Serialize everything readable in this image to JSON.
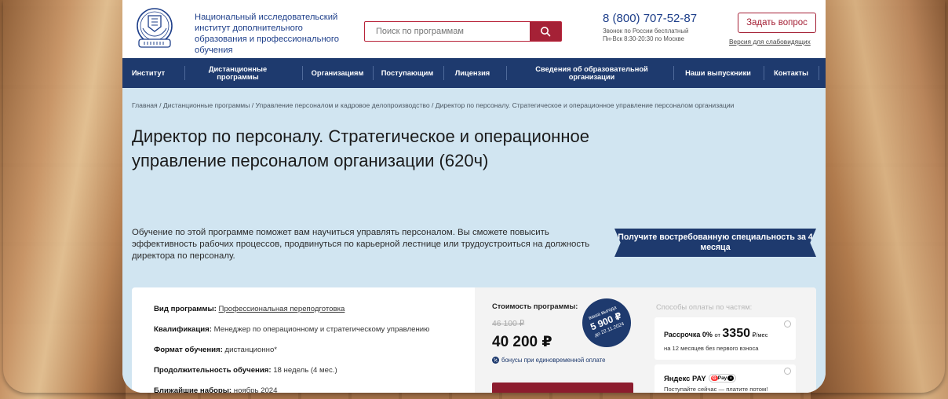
{
  "org": {
    "name": "Национальный исследовательский институт дополнительного образования и профессионального обучения"
  },
  "search": {
    "placeholder": "Поиск по программам"
  },
  "contact": {
    "phone": "8 (800) 707-52-87",
    "note1": "Звонок по России бесплатный",
    "note2": "Пн-Вск 8:30-20:30 по Москве",
    "ask_label": "Задать вопрос",
    "low_vision": "Версия для слабовидящих"
  },
  "nav": [
    "Институт",
    "Дистанционные программы",
    "Организациям",
    "Поступающим",
    "Лицензия",
    "Сведения об образовательной организации",
    "Наши выпускники",
    "Контакты"
  ],
  "breadcrumbs": "Главная / Дистанционные программы / Управление персоналом и кадровое делопроизводство / Директор по персоналу. Стратегическое и операционное управление персоналом организации",
  "hero": {
    "title": "Директор по персоналу. Стратегическое и операционное управление персоналом организации (620ч)",
    "description": "Обучение по этой программе поможет вам научиться управлять персоналом. Вы сможете повысить эффективность рабочих процессов, продвинуться по карьерной лестнице или трудоустроиться на должность директора по персоналу.",
    "banner": "Получите востребованную специальность за 4 месяца"
  },
  "program": {
    "type_label": "Вид программы:",
    "type_value": "Профессиональная переподготовка",
    "qual_label": "Квалификация:",
    "qual_value": "Менеджер по операционному и стратегическому управлению",
    "format_label": "Формат обучения:",
    "format_value": "дистанционно*",
    "duration_label": "Продолжительность обучения:",
    "duration_value": "18 недель (4 мес.)",
    "start_label": "Ближайшие наборы:",
    "start_value": "ноябрь 2024"
  },
  "price": {
    "label": "Стоимость программы:",
    "old": "46 100 ₽",
    "new": "40 200 ₽",
    "bonus": "бонусы при единовременной оплате",
    "badge_top": "ваша выгода",
    "badge_amount": "5 900 ₽",
    "badge_date": "до 22.11.2024"
  },
  "payment": {
    "title": "Способы оплаты по частям:",
    "installment_prefix": "Рассрочка 0%",
    "installment_from": "от",
    "installment_amount": "3350",
    "installment_unit": "₽/мес",
    "installment_note": "на 12 месяцев без первого взноса",
    "yandex_title": "Яндекс PAY",
    "yandex_note": "Поступайте сейчас — платите потом!"
  },
  "colors": {
    "brand_navy": "#1e3a6e",
    "brand_red": "#a52136",
    "hero_bg": "#d1e5f1"
  }
}
